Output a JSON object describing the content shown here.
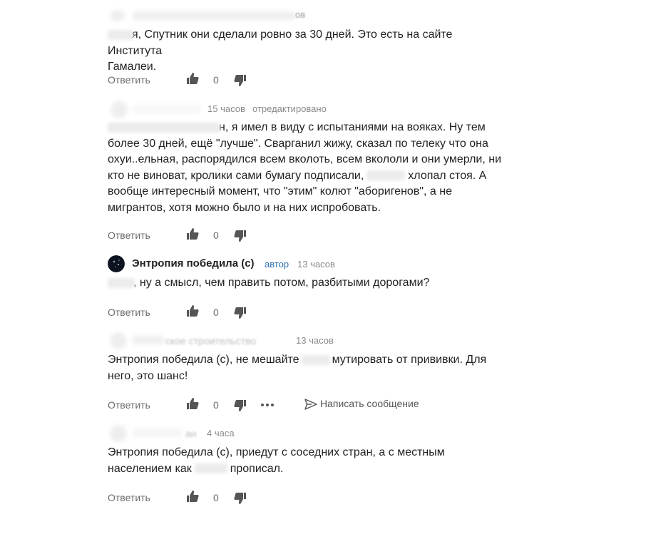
{
  "comments": [
    {
      "author_suffix": "ов",
      "time": "",
      "edited": "",
      "text_lines": [
        "я, Спутник они сделали ровно за 30 дней. Это есть на сайте Института",
        "Гамалеи."
      ],
      "likes": "0"
    },
    {
      "author_suffix": "",
      "time": "15 часов",
      "edited": "отредактировано",
      "text_lines": [
        "н, я имел в виду с испытаниями на вояках. Ну тем",
        "более 30 дней, ещё \"лучше\". Сварганил жижу, сказал по телеку что она",
        "охуи..ельная, распорядился всем вколоть, всем вкололи и они умерли, ни",
        "кто не виноват, кролики сами бумагу подписали,",
        "хлопал стоя. А",
        "вообще интересный момент, что \"этим\" колют \"аборигенов\", а не",
        "мигрантов, хотя можно было и на них испробовать."
      ],
      "likes": "0"
    },
    {
      "author_name": "Энтропия победила (с)",
      "author_tag": "автор",
      "time": "13 часов",
      "text_lines": [
        ", ну а смысл, чем править потом, разбитыми дорогами?"
      ],
      "likes": "0"
    },
    {
      "author_suffix": "ское строительство",
      "time": "13 часов",
      "text_lines": [
        "Энтропия победила (с), не мешайте",
        "мутировать от прививки. Для",
        "него, это шанс!"
      ],
      "likes": "0",
      "write_message": "Написать сообщение"
    },
    {
      "author_suffix": "ан",
      "time": "4 часа",
      "text_lines": [
        "Энтропия победила (с), приедут с соседних стран, а с местным",
        "населением как",
        "прописал."
      ],
      "likes": "0"
    }
  ],
  "actions": {
    "reply_label": "Ответить"
  },
  "icons": {
    "like": "thumbs-up-icon",
    "dislike": "thumbs-down-icon",
    "more": "more-dots-icon",
    "message": "paper-plane-icon"
  },
  "colors": {
    "text": "#222222",
    "meta": "#8a8a8a",
    "action": "#6b6b6b",
    "author_tag": "#2f6fb0"
  }
}
